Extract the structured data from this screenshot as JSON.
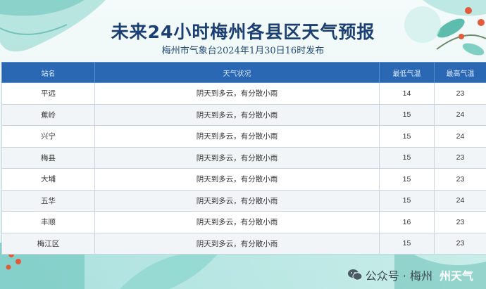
{
  "header": {
    "title": "未来24小时梅州各县区天气预报",
    "subtitle": "梅州市气象台2024年1月30日16时发布"
  },
  "table": {
    "columns": [
      "站名",
      "天气状况",
      "最低气温",
      "最高气温"
    ],
    "rows": [
      {
        "station": "平远",
        "weather": "阴天到多云，有分散小雨",
        "min": "14",
        "max": "23"
      },
      {
        "station": "蕉岭",
        "weather": "阴天到多云，有分散小雨",
        "min": "15",
        "max": "24"
      },
      {
        "station": "兴宁",
        "weather": "阴天到多云，有分散小雨",
        "min": "15",
        "max": "24"
      },
      {
        "station": "梅县",
        "weather": "阴天到多云，有分散小雨",
        "min": "15",
        "max": "23"
      },
      {
        "station": "大埔",
        "weather": "阴天到多云，有分散小雨",
        "min": "15",
        "max": "23"
      },
      {
        "station": "五华",
        "weather": "阴天到多云，有分散小雨",
        "min": "15",
        "max": "24"
      },
      {
        "station": "丰顺",
        "weather": "阴天到多云，有分散小雨",
        "min": "16",
        "max": "23"
      },
      {
        "station": "梅江区",
        "weather": "阴天到多云，有分散小雨",
        "min": "15",
        "max": "23"
      }
    ]
  },
  "watermark": {
    "text": "公众号 · 梅州",
    "tail": "州天气"
  },
  "colors": {
    "header_bar": "#2a68b4",
    "title": "#1b3f73"
  }
}
